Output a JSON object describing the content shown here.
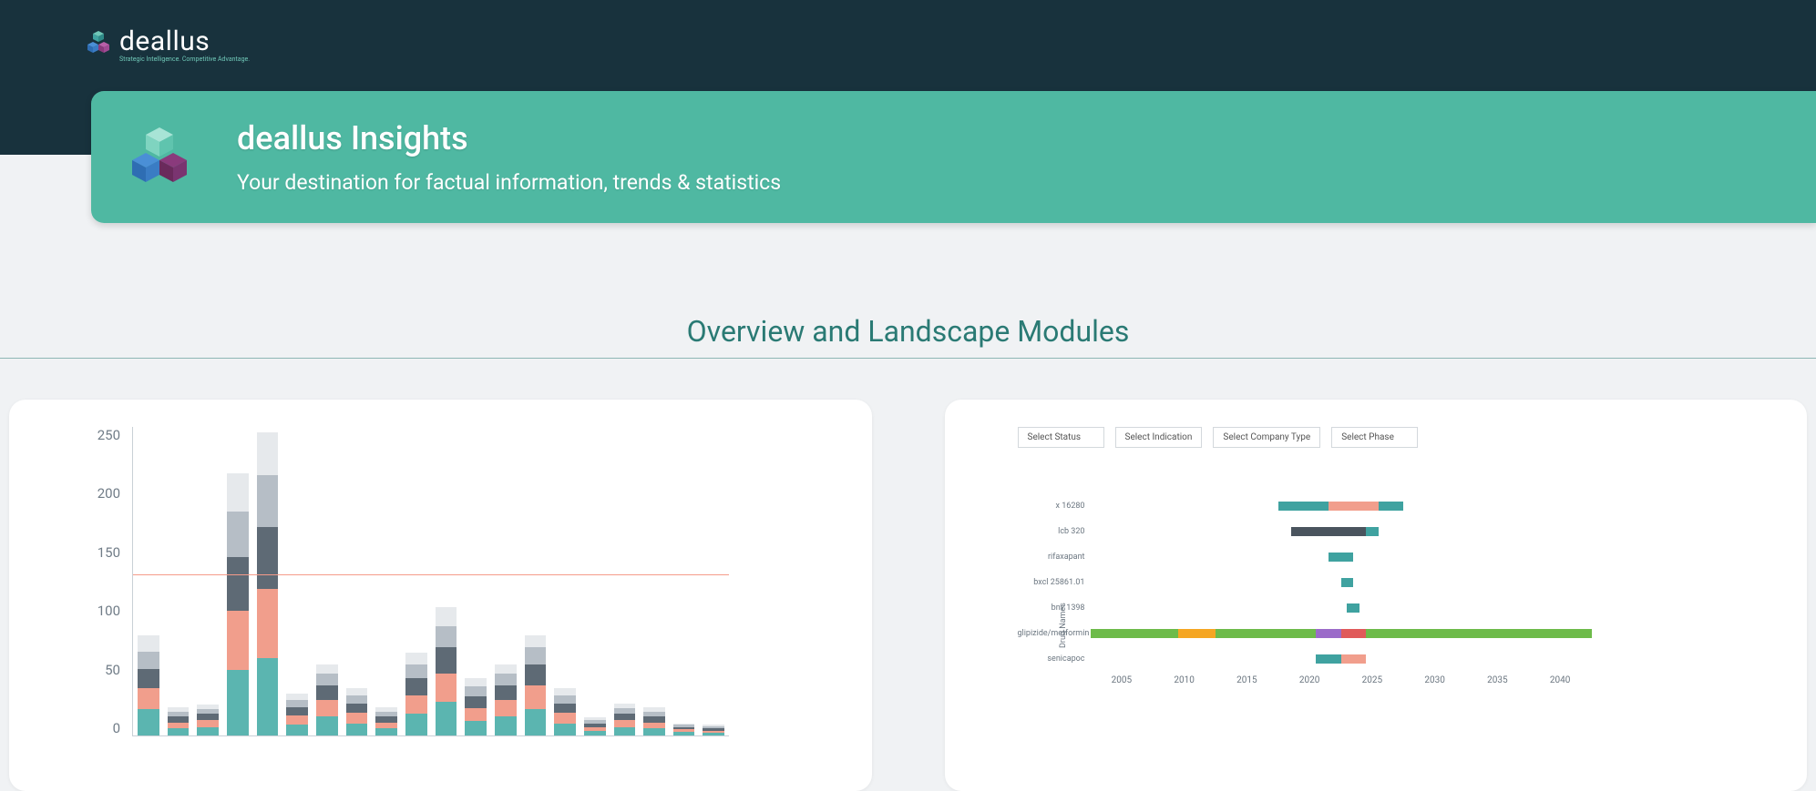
{
  "brand": {
    "name": "deallus",
    "tagline": "Strategic Intelligence. Competitive Advantage."
  },
  "banner": {
    "title": "deallus Insights",
    "subtitle": "Your destination for factual information, trends & statistics"
  },
  "section_title": "Overview and Landscape Modules",
  "chart_data": [
    {
      "type": "bar",
      "stacked": true,
      "ylim": [
        0,
        260
      ],
      "y_ticks": [
        0,
        50,
        100,
        150,
        200,
        250
      ],
      "reference_line_y": 135,
      "series_colors": {
        "a": "#5bb5b0",
        "b": "#f19e8c",
        "c": "#5e6a75",
        "d": "#b6bec6",
        "e": "#e6e9ec"
      },
      "categories_count": 20,
      "values": [
        {
          "segments": [
            22,
            18,
            16,
            14,
            14
          ]
        },
        {
          "segments": [
            6,
            5,
            5,
            4,
            4
          ]
        },
        {
          "segments": [
            7,
            6,
            5,
            4,
            4
          ]
        },
        {
          "segments": [
            55,
            50,
            45,
            38,
            32
          ]
        },
        {
          "segments": [
            65,
            58,
            52,
            44,
            36
          ]
        },
        {
          "segments": [
            9,
            8,
            7,
            6,
            5
          ]
        },
        {
          "segments": [
            16,
            14,
            12,
            10,
            8
          ]
        },
        {
          "segments": [
            10,
            9,
            8,
            7,
            6
          ]
        },
        {
          "segments": [
            6,
            5,
            5,
            4,
            4
          ]
        },
        {
          "segments": [
            18,
            16,
            14,
            12,
            10
          ]
        },
        {
          "segments": [
            28,
            24,
            22,
            18,
            16
          ]
        },
        {
          "segments": [
            12,
            11,
            10,
            8,
            7
          ]
        },
        {
          "segments": [
            16,
            14,
            12,
            10,
            8
          ]
        },
        {
          "segments": [
            22,
            20,
            18,
            14,
            10
          ]
        },
        {
          "segments": [
            10,
            9,
            8,
            7,
            6
          ]
        },
        {
          "segments": [
            4,
            3,
            3,
            3,
            2
          ]
        },
        {
          "segments": [
            7,
            6,
            5,
            5,
            4
          ]
        },
        {
          "segments": [
            6,
            5,
            5,
            4,
            4
          ]
        },
        {
          "segments": [
            3,
            2,
            2,
            2,
            1
          ]
        },
        {
          "segments": [
            2,
            2,
            2,
            2,
            1
          ]
        }
      ]
    },
    {
      "type": "gantt",
      "filters": [
        "Select Status",
        "Select Indication",
        "Select Company Type",
        "Select Phase"
      ],
      "ylabel": "Drug Names",
      "x_range": [
        2003,
        2043
      ],
      "x_ticks": [
        2005,
        2010,
        2015,
        2020,
        2025,
        2030,
        2035,
        2040
      ],
      "rows": [
        {
          "label": "x 16280",
          "segments": [
            {
              "start": 2018,
              "end": 2022,
              "color": "#3fa2a0"
            },
            {
              "start": 2022,
              "end": 2026,
              "color": "#f19e8c"
            },
            {
              "start": 2026,
              "end": 2028,
              "color": "#3fa2a0"
            }
          ]
        },
        {
          "label": "lcb 320",
          "segments": [
            {
              "start": 2019,
              "end": 2025,
              "color": "#4a545e"
            },
            {
              "start": 2025,
              "end": 2026,
              "color": "#3fa2a0"
            }
          ]
        },
        {
          "label": "rifaxapant",
          "segments": [
            {
              "start": 2022,
              "end": 2024,
              "color": "#3fa2a0"
            }
          ]
        },
        {
          "label": "bxcl 25861.01",
          "segments": [
            {
              "start": 2023,
              "end": 2024,
              "color": "#3fa2a0"
            }
          ]
        },
        {
          "label": "bnv 1398",
          "segments": [
            {
              "start": 2023.5,
              "end": 2024.5,
              "color": "#3fa2a0"
            }
          ]
        },
        {
          "label": "glipizide/metformin",
          "segments": [
            {
              "start": 2003,
              "end": 2010,
              "color": "#6dbb4a"
            },
            {
              "start": 2010,
              "end": 2013,
              "color": "#f5a623"
            },
            {
              "start": 2013,
              "end": 2021,
              "color": "#6dbb4a"
            },
            {
              "start": 2021,
              "end": 2023,
              "color": "#9b6bc9"
            },
            {
              "start": 2023,
              "end": 2025,
              "color": "#e05a5a"
            },
            {
              "start": 2025,
              "end": 2043,
              "color": "#6dbb4a"
            }
          ]
        },
        {
          "label": "senicapoc",
          "segments": [
            {
              "start": 2021,
              "end": 2023,
              "color": "#3fa2a0"
            },
            {
              "start": 2023,
              "end": 2025,
              "color": "#f19e8c"
            }
          ]
        }
      ]
    }
  ]
}
